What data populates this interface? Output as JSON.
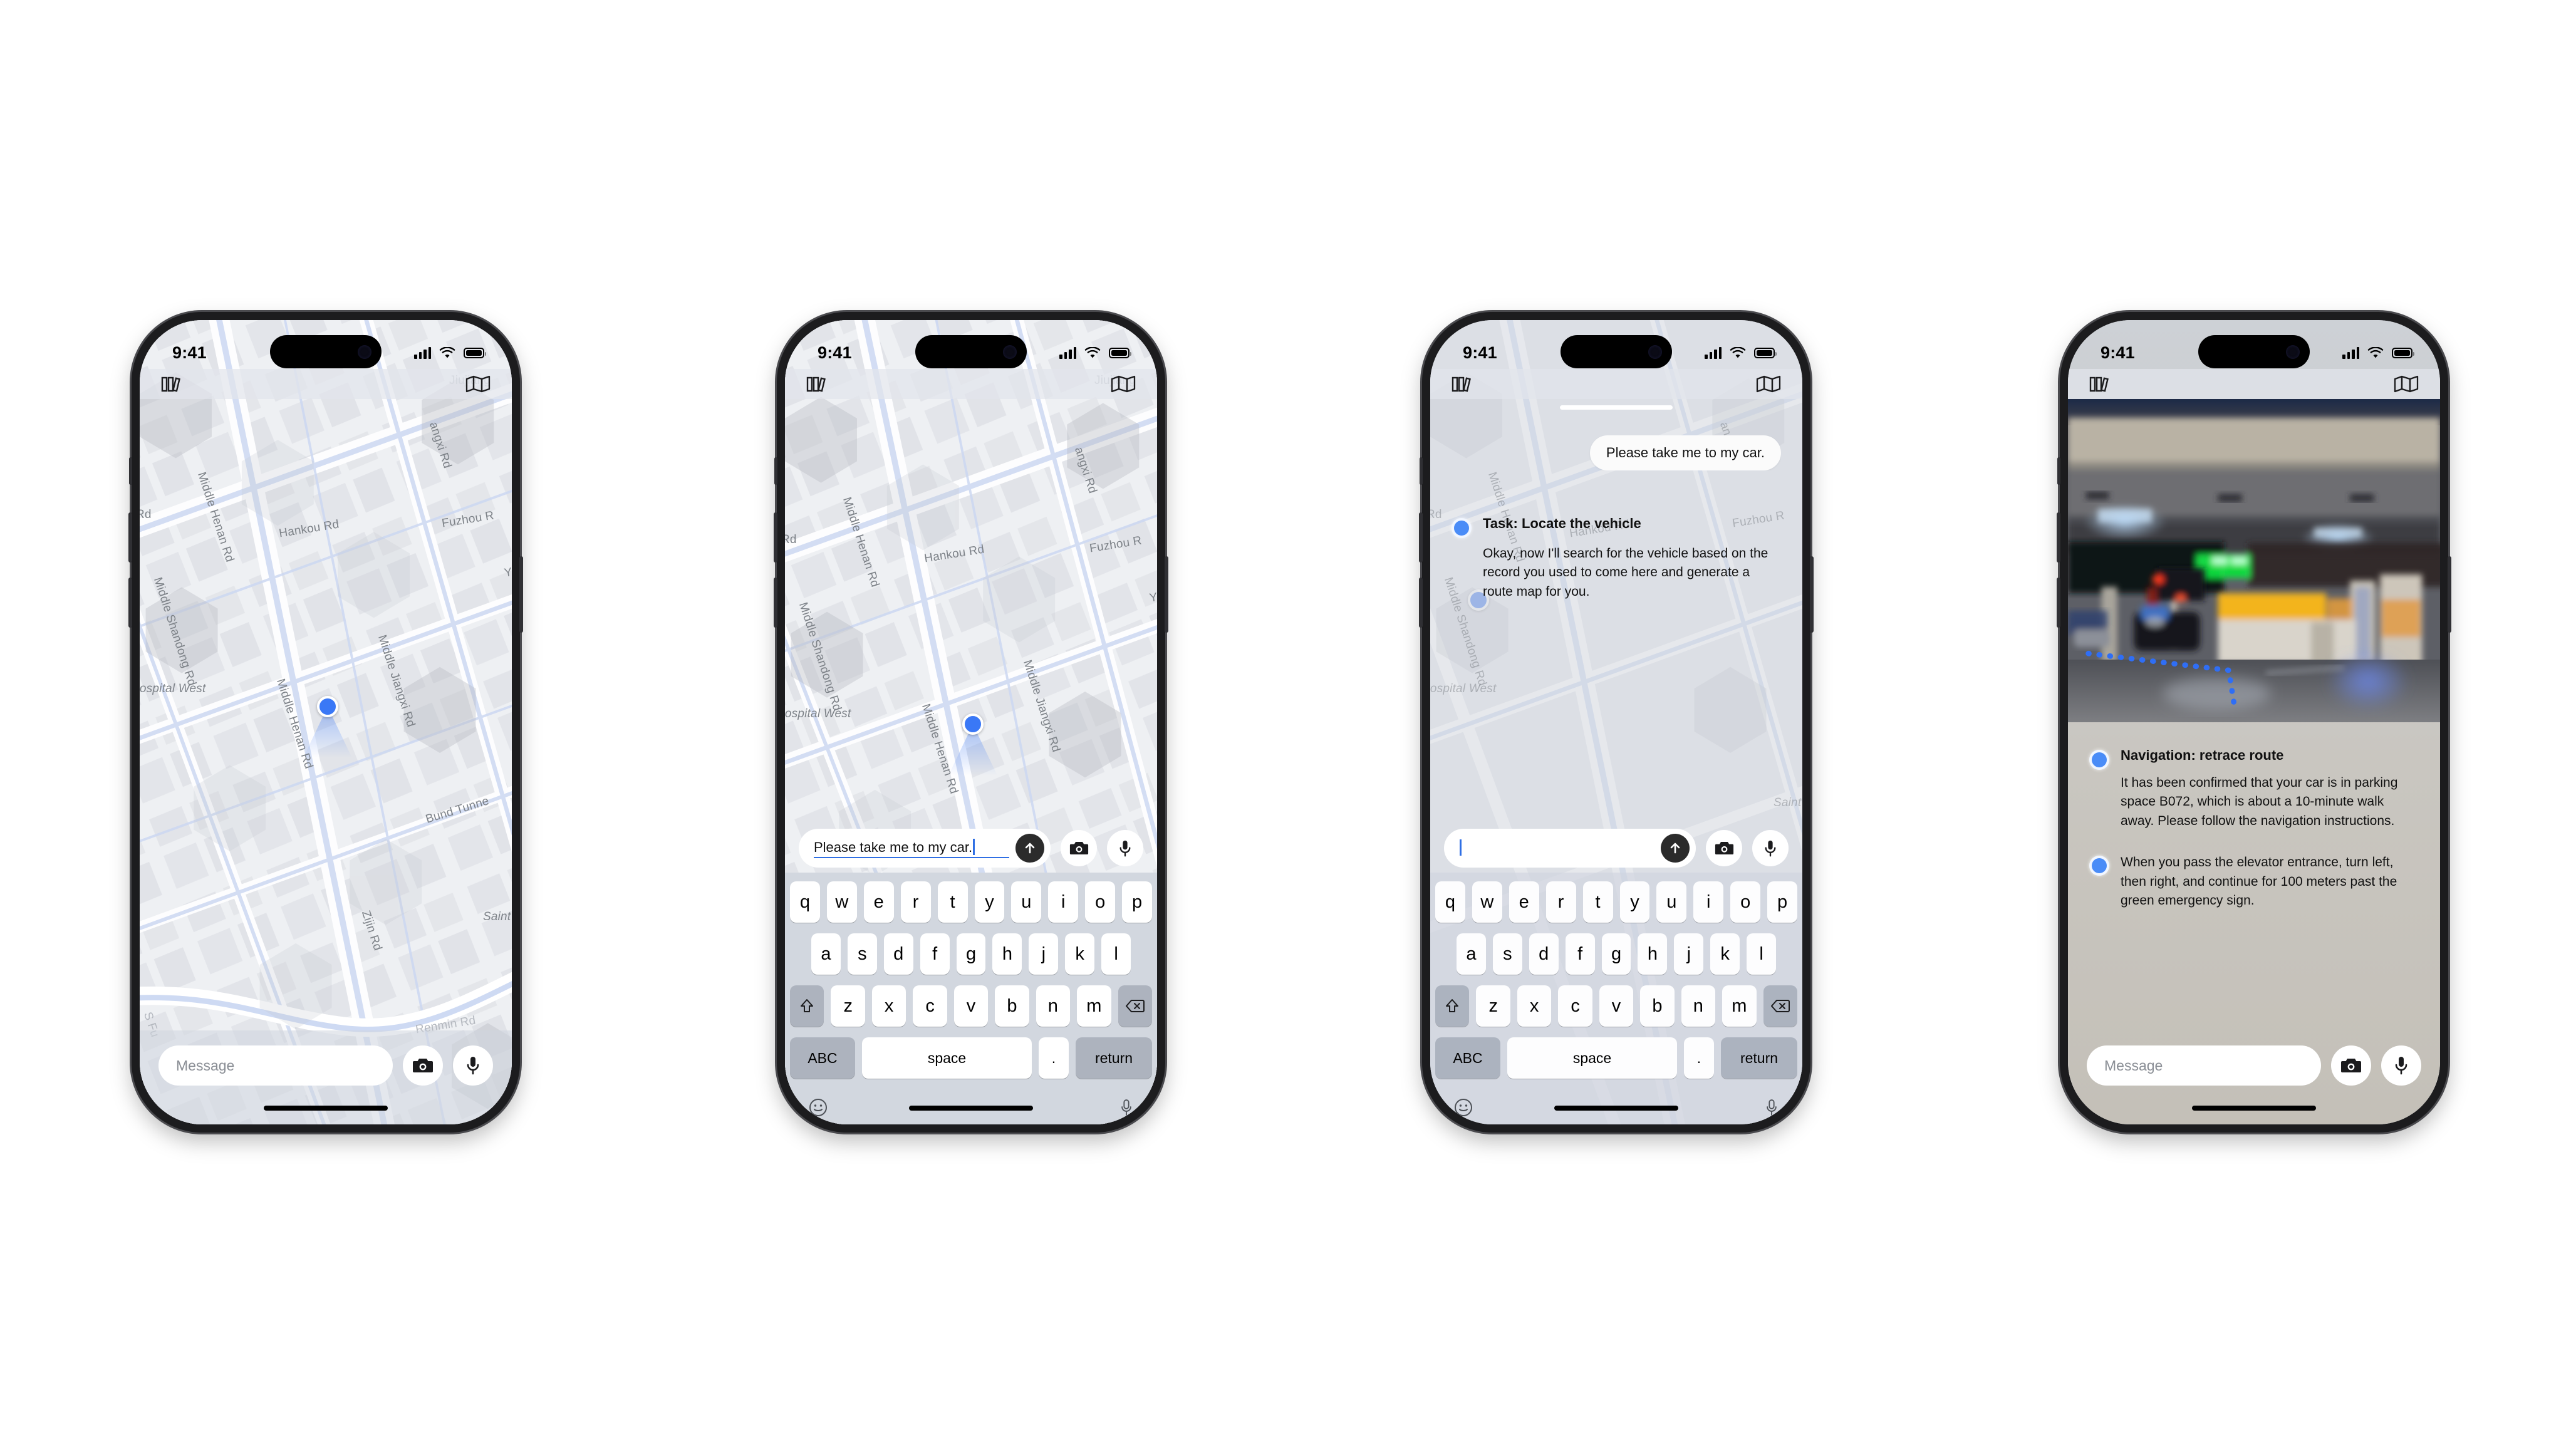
{
  "status_bar": {
    "time": "9:41",
    "wifi_icon": "wifi-icon",
    "cellular_icon": "cellular-signal-icon",
    "battery_icon": "battery-icon"
  },
  "nav_bar": {
    "left_icon": "books-library-icon",
    "right_icon": "folded-map-icon"
  },
  "map": {
    "labels": [
      "Middle Henan Rd",
      "Hankou Rd",
      "Middle Shandong Rd",
      "Fuzhou R",
      "Middle Jiangxi Rd",
      "Jiujiang",
      "Bund Tunne",
      "Zijin Rd",
      "Saint J",
      "Hospital West",
      "Renmin Rd",
      "S Fu",
      "Rd",
      "Yu",
      "Middle",
      "angxi Rd"
    ],
    "location_marker": "current-location-dot"
  },
  "phones": [
    {
      "id": "phone-map-idle",
      "compose": {
        "placeholder": "Message",
        "camera_icon": "camera-icon",
        "mic_icon": "microphone-icon"
      }
    },
    {
      "id": "phone-typing",
      "input": {
        "value": "Please take me to my car.",
        "send_icon": "send-arrow-up-icon",
        "camera_icon": "camera-icon",
        "mic_icon": "microphone-icon"
      }
    },
    {
      "id": "phone-agent-reply",
      "input": {
        "value": "",
        "send_icon": "send-arrow-up-icon",
        "camera_icon": "camera-icon",
        "mic_icon": "microphone-icon"
      },
      "messages": [
        {
          "role": "user",
          "text": "Please take me to my car."
        },
        {
          "role": "agent",
          "title": "Task: Locate the vehicle",
          "text": "Okay, now I'll search for the vehicle based on the record you used to come here and generate a route map for you."
        }
      ]
    },
    {
      "id": "phone-navigation",
      "photo_alt": "parking-garage-photo",
      "messages": [
        {
          "role": "agent",
          "title": "Navigation: retrace route",
          "text": "It has been confirmed that your car is in parking space B072, which is about a 10-minute walk away. Please follow the navigation instructions."
        },
        {
          "role": "agent",
          "title": "",
          "text": "When you pass the elevator entrance, turn left, then right, and continue for 100 meters past the green emergency sign."
        }
      ],
      "compose": {
        "placeholder": "Message",
        "camera_icon": "camera-icon",
        "mic_icon": "microphone-icon"
      }
    }
  ],
  "keyboard": {
    "row1": [
      "q",
      "w",
      "e",
      "r",
      "t",
      "y",
      "u",
      "i",
      "o",
      "p"
    ],
    "row2": [
      "a",
      "s",
      "d",
      "f",
      "g",
      "h",
      "j",
      "k",
      "l"
    ],
    "row3": [
      "z",
      "x",
      "c",
      "v",
      "b",
      "n",
      "m"
    ],
    "shift_icon": "shift-up-arrow-icon",
    "backspace_icon": "backspace-delete-icon",
    "abc_label": "ABC",
    "space_label": "space",
    "period_label": ".",
    "return_label": "return",
    "emoji_icon": "emoji-smiley-icon",
    "dictation_icon": "microphone-icon"
  },
  "colors": {
    "accent_blue": "#3a78f6",
    "agent_blue": "#4a8cf7",
    "cursor_blue": "#2f6fe4",
    "key_dark": "#adb3be"
  }
}
